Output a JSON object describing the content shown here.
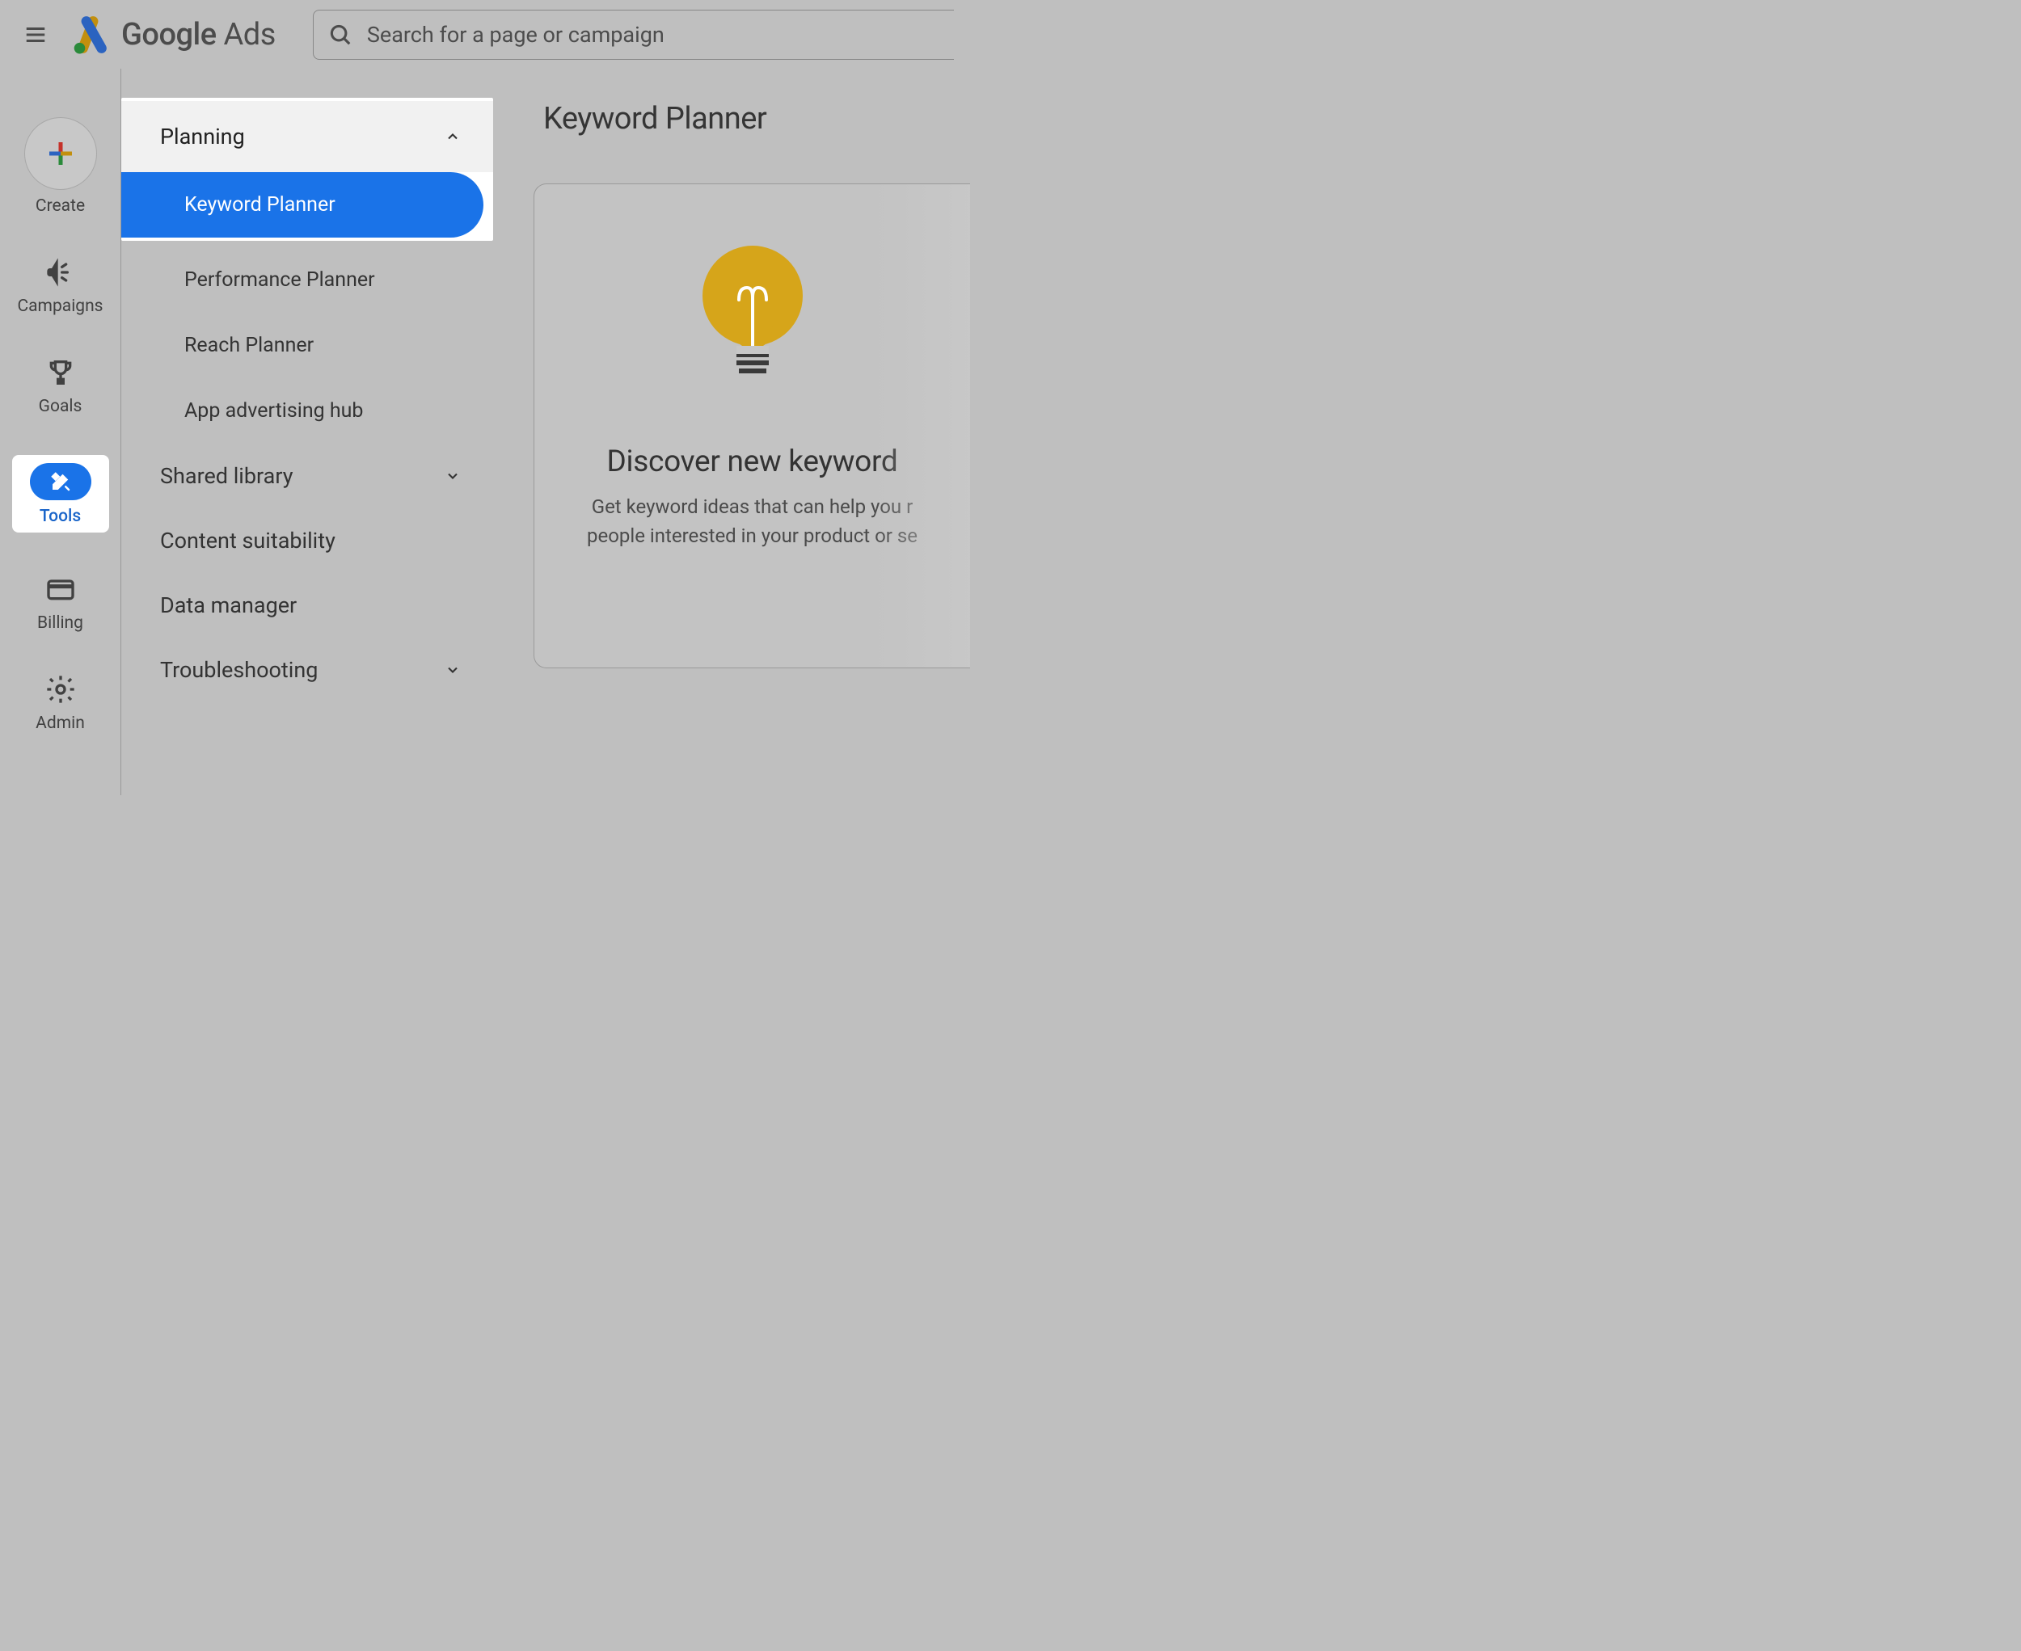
{
  "header": {
    "brand_google": "Google",
    "brand_ads": " Ads",
    "search_placeholder": "Search for a page or campaign"
  },
  "rail": {
    "create": "Create",
    "campaigns": "Campaigns",
    "goals": "Goals",
    "tools": "Tools",
    "billing": "Billing",
    "admin": "Admin"
  },
  "nav": {
    "planning": "Planning",
    "keyword_planner": "Keyword Planner",
    "performance_planner": "Performance Planner",
    "reach_planner": "Reach Planner",
    "app_advertising_hub": "App advertising hub",
    "shared_library": "Shared library",
    "content_suitability": "Content suitability",
    "data_manager": "Data manager",
    "troubleshooting": "Troubleshooting"
  },
  "main": {
    "page_title": "Keyword Planner",
    "card_title": "Discover new keyword",
    "card_desc_line1": "Get keyword ideas that can help you r",
    "card_desc_line2": "people interested in your product or se"
  }
}
